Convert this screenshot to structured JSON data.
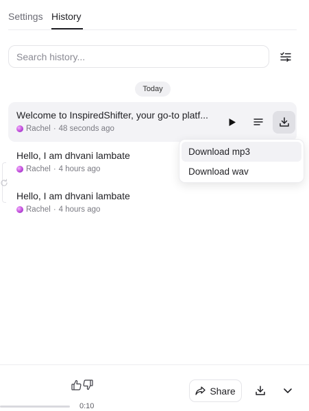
{
  "tabs": [
    {
      "label": "Settings",
      "active": false
    },
    {
      "label": "History",
      "active": true
    }
  ],
  "search": {
    "placeholder": "Search history...",
    "value": ""
  },
  "filter_icon": "list-filter-icon",
  "date_group": "Today",
  "history_items": [
    {
      "title": "Welcome to InspiredShifter, your go-to platf...",
      "voice": "Rachel",
      "time": "48 seconds ago",
      "separator": "·",
      "active": true
    },
    {
      "title": "Hello, I am dhvani lambate",
      "voice": "Rachel",
      "time": "4 hours ago",
      "separator": "·",
      "active": false
    },
    {
      "title": "Hello, I am dhvani lambate",
      "voice": "Rachel",
      "time": "4 hours ago",
      "separator": "·",
      "active": false
    }
  ],
  "item_actions": {
    "play_icon": "play-icon",
    "details_icon": "lines-icon",
    "download_icon": "download-icon"
  },
  "download_menu": [
    {
      "label": "Download mp3",
      "highlighted": true
    },
    {
      "label": "Download wav",
      "highlighted": false
    }
  ],
  "player": {
    "time": "0:10",
    "progress_fraction": 1.0,
    "share_label": "Share",
    "thumbs_up_icon": "thumbs-up-icon",
    "thumbs_down_icon": "thumbs-down-icon",
    "download_icon": "download-icon",
    "expand_icon": "chevron-down-icon"
  },
  "colors": {
    "accent": "#1f1f23",
    "active_row": "#f3f3f6",
    "pressed_button": "#e0e0e5",
    "avatar": "#c04bd8"
  }
}
